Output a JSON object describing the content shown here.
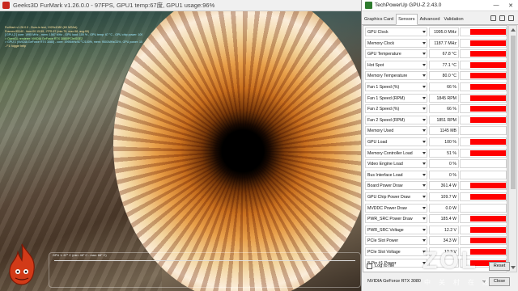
{
  "furmark": {
    "title": "Geeks3D FurMark v1.26.0.0 - 97FPS, GPU1 temp:67度, GPU1 usage:96%",
    "osd_lines": [
      "FurMark v1.26.0.0 - Burn-in test, 1920x1080 (8X MSAA)",
      "Frames:95140 - time:00:15:59 - FPS:97 (min:79, max:98, avg:99)",
      "[ GPU-Z ] core: 1995 MHz - mem: 1567 MHz - GPU load: 100 % - GPU temp: 67 °C - GPU chip power: 109.7 W (PPW: 0.884) - Board power: 361.4 W (PPW: 0.268) - GPU voltage: 0.987 V",
      "> OpenGL renderer: NVIDIA GeForce RTX 3080/PCIe/SSE2",
      "> GPU 1 (NVIDIA GeForce RTX 3080) - core: 1995MHz/67°C/100%, mem: 9501MHz/33%, GPU power: 100.0% TDP, fan: 66%, limits[power:1, temp:0, volt:0, OV:0]",
      "- F1: toggle help"
    ],
    "graph_label": "GPU 1: 67° C (min: 46° C - max: 68° C)",
    "logo_icon": "furmark-logo-icon"
  },
  "gpuz": {
    "title": "TechPowerUp GPU-Z 2.43.0",
    "minimize": "—",
    "close": "✕",
    "tabs": [
      "Graphics Card",
      "Sensors",
      "Advanced",
      "Validation"
    ],
    "active_tab": "Sensors",
    "sensors": [
      {
        "name": "GPU Clock",
        "value": "1995.0 MHz",
        "level": 0.78
      },
      {
        "name": "Memory Clock",
        "value": "1187.7 MHz",
        "level": 0.78
      },
      {
        "name": "GPU Temperature",
        "value": "67.8 °C",
        "level": 0.78
      },
      {
        "name": "Hot Spot",
        "value": "77.1 °C",
        "level": 0.78
      },
      {
        "name": "Memory Temperature",
        "value": "80.0 °C",
        "level": 0.78
      },
      {
        "name": "Fan 1 Speed (%)",
        "value": "66 %",
        "level": 0.78
      },
      {
        "name": "Fan 1 Speed (RPM)",
        "value": "1845 RPM",
        "level": 0.78
      },
      {
        "name": "Fan 2 Speed (%)",
        "value": "66 %",
        "level": 0.78
      },
      {
        "name": "Fan 2 Speed (RPM)",
        "value": "1851 RPM",
        "level": 0.78
      },
      {
        "name": "Memory Used",
        "value": "1145 MB",
        "level": 0.0
      },
      {
        "name": "GPU Load",
        "value": "100 %",
        "level": 0.78
      },
      {
        "name": "Memory Controller Load",
        "value": "51 %",
        "level": 0.78
      },
      {
        "name": "Video Engine Load",
        "value": "0 %",
        "level": 0.0
      },
      {
        "name": "Bus Interface Load",
        "value": "0 %",
        "level": 0.0
      },
      {
        "name": "Board Power Draw",
        "value": "361.4 W",
        "level": 0.78
      },
      {
        "name": "GPU Chip Power Draw",
        "value": "109.7 W",
        "level": 0.78
      },
      {
        "name": "MVDDC Power Draw",
        "value": "0.0 W",
        "level": 0.0
      },
      {
        "name": "PWR_SRC Power Draw",
        "value": "185.4 W",
        "level": 0.78
      },
      {
        "name": "PWR_SRC Voltage",
        "value": "12.2 V",
        "level": 0.78
      },
      {
        "name": "PCIe Slot Power",
        "value": "34.3 W",
        "level": 0.78
      },
      {
        "name": "PCIe Slot Voltage",
        "value": "12.3 V",
        "level": 0.78
      },
      {
        "name": "8-Pin #1 Power",
        "value": "",
        "level": 0.78
      }
    ],
    "log_to_file": "Log to file",
    "reset_label": "Reset",
    "gpu_name": "NVIDIA GeForce RTX 3080",
    "close_label": "Close",
    "bar_color": "#ff0000"
  },
  "watermark": {
    "brand": "ZOL",
    "subtitle": "中关村在线"
  }
}
